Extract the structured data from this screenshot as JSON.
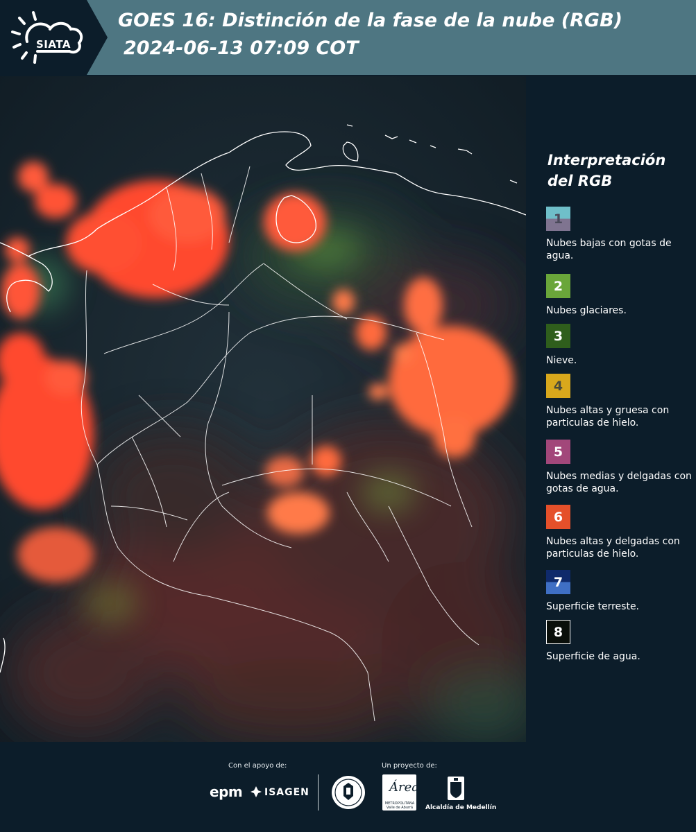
{
  "header": {
    "logo_text": "SIATA",
    "title_line1": "GOES 16: Distinción de la fase de la nube (RGB)",
    "title_line2": "2024-06-13 07:09 COT"
  },
  "legend": {
    "title": "Interpretación del RGB",
    "items": [
      {
        "number": "1",
        "label": "Nubes bajas con gotas de agua.",
        "color_top": "#6fbfc9",
        "color_bottom": "#7f7490",
        "text_color": "#4a4a5a"
      },
      {
        "number": "2",
        "label": "Nubes glaciares.",
        "color_top": "#6aa63a",
        "color_bottom": "#6aa63a",
        "text_color": "#ffffff"
      },
      {
        "number": "3",
        "label": "Nieve.",
        "color_top": "#2f5e1c",
        "color_bottom": "#2f5e1c",
        "text_color": "#ffffff"
      },
      {
        "number": "4",
        "label": "Nubes altas y gruesa con particulas de hielo.",
        "color_top": "#d9a81c",
        "color_bottom": "#d9a81c",
        "text_color": "#4a4a3a"
      },
      {
        "number": "5",
        "label": "Nubes medias y delgadas con gotas de agua.",
        "color_top": "#a2477a",
        "color_bottom": "#a2477a",
        "text_color": "#ffffff"
      },
      {
        "number": "6",
        "label": "Nubes altas y delgadas con particulas de hielo.",
        "color_top": "#e5502a",
        "color_bottom": "#e5502a",
        "text_color": "#ffffff"
      },
      {
        "number": "7",
        "label": "Superficie terreste.",
        "color_top": "#0f2a6b",
        "color_bottom": "#3f6fc4",
        "text_color": "#ffffff"
      },
      {
        "number": "8",
        "label": "Superficie de agua.",
        "color_top": "#0a0f0a",
        "color_bottom": "#0a0f0a",
        "text_color": "#ffffff"
      }
    ]
  },
  "footer": {
    "support_label": "Con el apoyo de:",
    "project_label": "Un proyecto de:",
    "epm_text": "epm",
    "isagen_text": "ISAGEN",
    "area_word": "Área",
    "area_small": "METROPOLITANA Valle de Aburrá",
    "alcaldia_label": "Alcaldía de Medellín"
  },
  "colors": {
    "background": "#0c1d2a",
    "header_band": "#4e7682",
    "cloud_red": "#ff4a2e",
    "cloud_orange": "#f07a42",
    "border_white": "#ffffff"
  }
}
